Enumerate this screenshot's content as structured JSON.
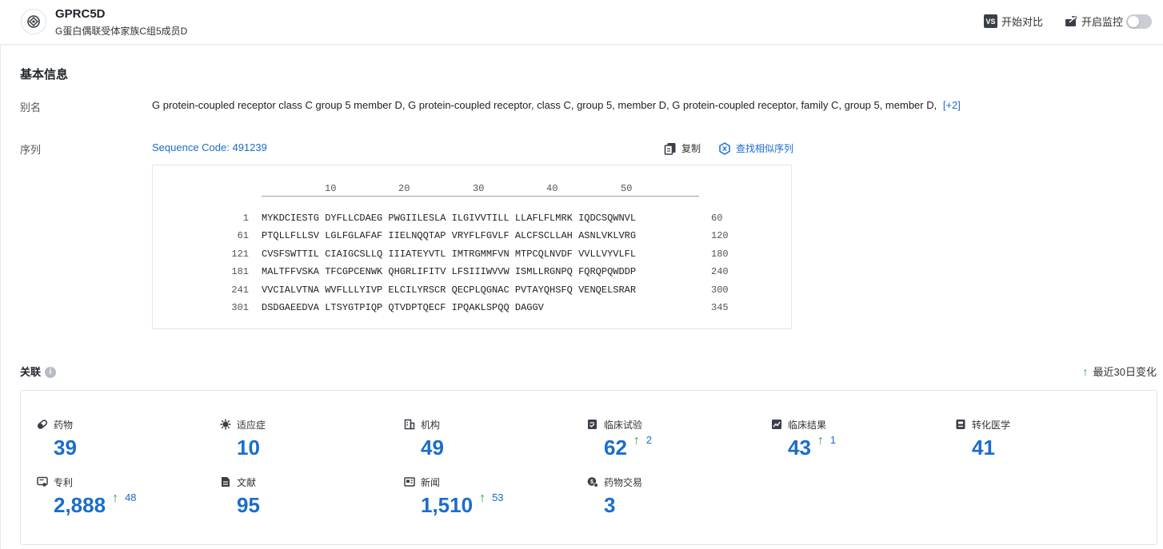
{
  "header": {
    "title": "GPRC5D",
    "subtitle": "G蛋白偶联受体家族C组5成员D",
    "compare_label": "开始对比",
    "compare_badge": "VS",
    "monitor_label": "开启监控",
    "monitor_on": false
  },
  "basic": {
    "section_title": "基本信息",
    "alias_label": "别名",
    "aliases": "G protein-coupled receptor class C group 5 member D,  G protein-coupled receptor, class C, group 5, member D,  G protein-coupled receptor, family C, group 5, member D,",
    "alias_more": "[+2]",
    "sequence_label": "序列",
    "sequence_code": "Sequence Code: 491239",
    "copy_label": "复制",
    "find_similar_label": "查找相似序列",
    "ruler_ticks": [
      "10",
      "20",
      "30",
      "40",
      "50"
    ],
    "sequence_rows": [
      {
        "start": "1",
        "seq": "MYKDCIESTG DYFLLCDAEG PWGIILESLA ILGIVVTILL LLAFLFLMRK IQDCSQWNVL",
        "end": "60"
      },
      {
        "start": "61",
        "seq": "PTQLLFLLSV LGLFGLAFAF IIELNQQTAP VRYFLFGVLF ALCFSCLLAH ASNLVKLVRG",
        "end": "120"
      },
      {
        "start": "121",
        "seq": "CVSFSWTTIL CIAIGCSLLQ IIIATEYVTL IMTRGMMFVN MTPCQLNVDF VVLLVYVLFL",
        "end": "180"
      },
      {
        "start": "181",
        "seq": "MALTFFVSKA TFCGPCENWK QHGRLIFITV LFSIIIWVVW ISMLLRGNPQ FQRQPQWDDP",
        "end": "240"
      },
      {
        "start": "241",
        "seq": "VVCIALVTNA WVFLLLYIVP ELCILYRSCR QECPLQGNAC PVTAYQHSFQ VENQELSRAR",
        "end": "300"
      },
      {
        "start": "301",
        "seq": "DSDGAEEDVA LTSYGTPIQP QTVDPTQECF IPQAKLSPQQ DAGGV",
        "end": "345"
      }
    ]
  },
  "related": {
    "section_title": "关联",
    "info_icon": "info-icon",
    "trend_label": "最近30日变化",
    "colors": {
      "value": "#1a6dcc",
      "up": "#2e9a3a"
    },
    "stats": [
      {
        "label": "药物",
        "icon": "pill-icon",
        "value": "39",
        "delta": ""
      },
      {
        "label": "适应症",
        "icon": "virus-icon",
        "value": "10",
        "delta": ""
      },
      {
        "label": "机构",
        "icon": "building-icon",
        "value": "49",
        "delta": ""
      },
      {
        "label": "临床试验",
        "icon": "clinical-trial-icon",
        "value": "62",
        "delta": "2"
      },
      {
        "label": "临床结果",
        "icon": "clinical-result-icon",
        "value": "43",
        "delta": "1"
      },
      {
        "label": "转化医学",
        "icon": "translational-medicine-icon",
        "value": "41",
        "delta": ""
      },
      {
        "label": "专利",
        "icon": "patent-icon",
        "value": "2,888",
        "delta": "48"
      },
      {
        "label": "文献",
        "icon": "document-icon",
        "value": "95",
        "delta": ""
      },
      {
        "label": "新闻",
        "icon": "news-icon",
        "value": "1,510",
        "delta": "53"
      },
      {
        "label": "药物交易",
        "icon": "deal-icon",
        "value": "3",
        "delta": ""
      }
    ]
  }
}
